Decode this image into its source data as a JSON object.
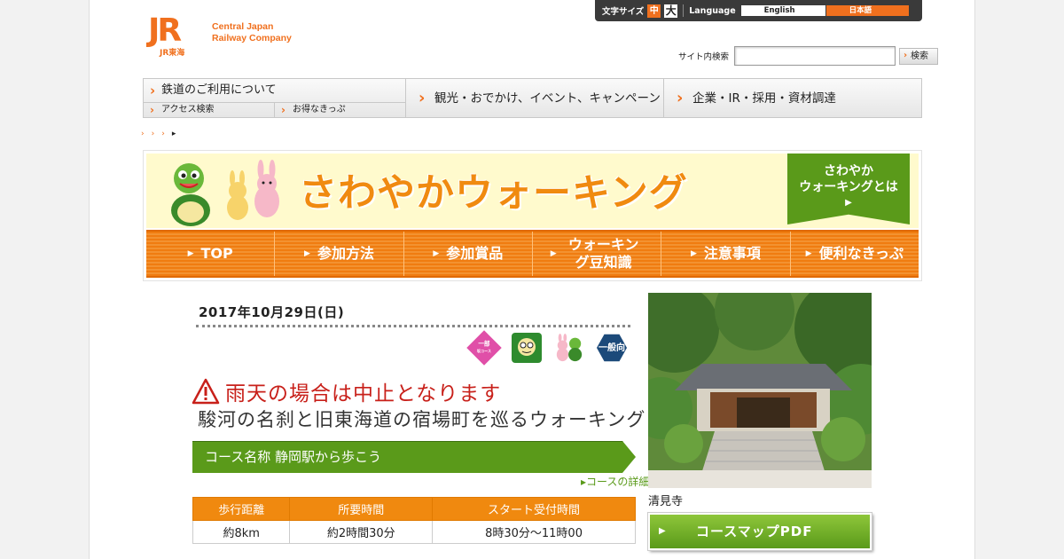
{
  "header": {
    "logo_mark": "JR",
    "logo_sub": "JR東海",
    "logo_line1": "Central Japan",
    "logo_line2": "Railway Company",
    "font_size_label": "文字サイズ",
    "font_mid": "中",
    "font_big": "大",
    "language_label": "Language",
    "lang_en": "English",
    "lang_jp": "日本語",
    "search_label": "サイト内検索",
    "search_value": "",
    "search_button": "検索"
  },
  "nav": {
    "rail_use": "鉄道のご利用について",
    "access_search": "アクセス検索",
    "tickets": "お得なきっぷ",
    "sightseeing": "観光・おでかけ、イベント、キャンペーン",
    "corporate": "企業・IR・採用・資材調達"
  },
  "breadcrumbs": [
    "›",
    "›",
    "›",
    "▸"
  ],
  "banner": {
    "title": "さわやかウォーキング",
    "whatis_line1": "さわやか",
    "whatis_line2": "ウォーキングとは",
    "whatis_arrow": "▶",
    "tabs": [
      {
        "label": "TOP"
      },
      {
        "label": "参加方法"
      },
      {
        "label": "参加賞品"
      },
      {
        "label": "ウォーキング豆知識"
      },
      {
        "label": "注意事項"
      },
      {
        "label": "便利なきっぷ"
      }
    ]
  },
  "event": {
    "date": "2017年10月29日(日)",
    "badges": {
      "partial": "一部",
      "partial_sub": "坂コース",
      "general": "一般向"
    },
    "warning": "雨天の場合は中止となります",
    "subtitle": "駿河の名刹と旧東海道の宿場町を巡るウォーキング",
    "course_title": "コース名称 静岡駅から歩こう",
    "course_link": "▸コースの詳細",
    "table_headers": [
      "歩行距離",
      "所要時間",
      "スタート受付時間"
    ],
    "table_values": [
      "約8km",
      "約2時間30分",
      "8時30分〜11時00"
    ],
    "photo_caption": "清見寺",
    "map_button": "コースマップPDF",
    "map_arrow": "▶"
  },
  "colors": {
    "accent": "#f0701e",
    "green": "#5a9a1a",
    "banner_orange": "#f0890f"
  }
}
